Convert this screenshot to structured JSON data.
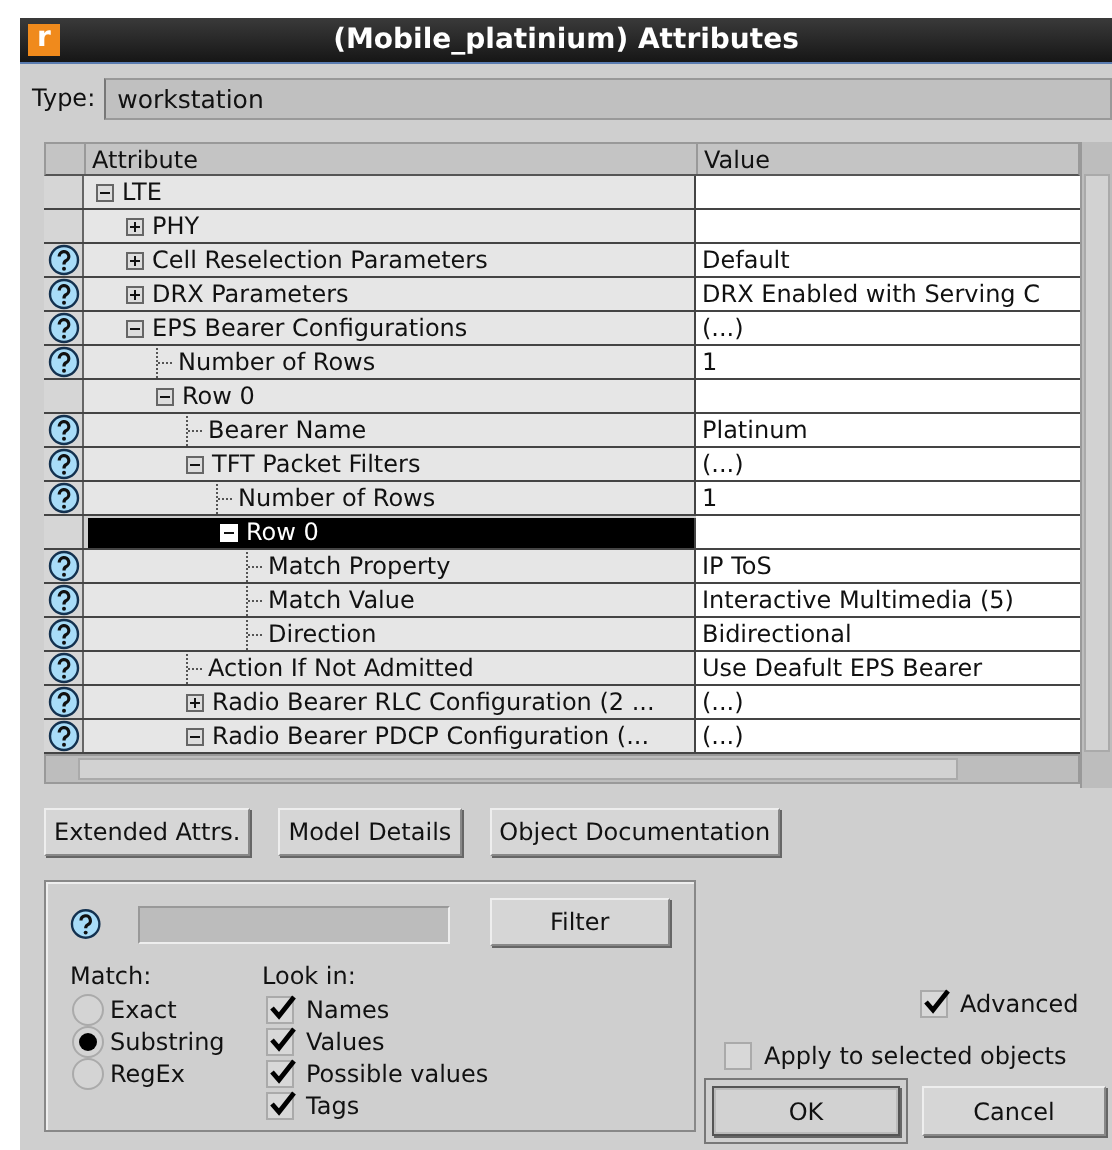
{
  "window": {
    "logo": "r",
    "title": "(Mobile_platinium) Attributes"
  },
  "type": {
    "label": "Type:",
    "value": "workstation"
  },
  "table": {
    "columns": [
      "Attribute",
      "Value"
    ],
    "rows": [
      {
        "name": "LTE",
        "kind": "group",
        "expanded": true,
        "help": false,
        "selected": false,
        "children": [
          {
            "name": "PHY",
            "kind": "group",
            "expanded": false,
            "help": false,
            "selected": false
          },
          {
            "name": "Cell Reselection Parameters",
            "value": "Default",
            "kind": "group",
            "expanded": false,
            "help": true,
            "selected": false
          },
          {
            "name": "DRX Parameters",
            "value": "DRX Enabled with Serving C",
            "kind": "group",
            "expanded": false,
            "help": true,
            "selected": false
          },
          {
            "name": "EPS Bearer Configurations",
            "value": "(...)",
            "kind": "group",
            "expanded": true,
            "help": true,
            "selected": false,
            "children": [
              {
                "name": "Number of Rows",
                "value": "1",
                "kind": "leaf",
                "help": true,
                "selected": false
              },
              {
                "name": "Row 0",
                "kind": "group",
                "expanded": true,
                "help": false,
                "selected": false,
                "children": [
                  {
                    "name": "Bearer Name",
                    "value": "Platinum",
                    "kind": "leaf",
                    "help": true,
                    "selected": false
                  },
                  {
                    "name": "TFT Packet Filters",
                    "value": "(...)",
                    "kind": "group",
                    "expanded": true,
                    "help": true,
                    "selected": false,
                    "children": [
                      {
                        "name": "Number of Rows",
                        "value": "1",
                        "kind": "leaf",
                        "help": true,
                        "selected": false
                      },
                      {
                        "name": "Row 0",
                        "kind": "group",
                        "expanded": true,
                        "help": false,
                        "selected": true,
                        "children": [
                          {
                            "name": "Match Property",
                            "value": "IP ToS",
                            "kind": "leaf",
                            "help": true,
                            "selected": false
                          },
                          {
                            "name": "Match Value",
                            "value": "Interactive Multimedia (5)",
                            "kind": "leaf",
                            "help": true,
                            "selected": false
                          },
                          {
                            "name": "Direction",
                            "value": "Bidirectional",
                            "kind": "leaf",
                            "help": true,
                            "selected": false
                          }
                        ]
                      }
                    ]
                  },
                  {
                    "name": "Action If Not Admitted",
                    "value": "Use Deafult EPS Bearer",
                    "kind": "leaf",
                    "help": true,
                    "selected": false
                  },
                  {
                    "name": "Radio Bearer RLC Configuration (2 ...",
                    "value": "(...)",
                    "kind": "group",
                    "expanded": false,
                    "help": true,
                    "selected": false
                  },
                  {
                    "name": "Radio Bearer PDCP Configuration (...",
                    "value": "(...)",
                    "kind": "group",
                    "expanded": true,
                    "help": true,
                    "selected": false
                  }
                ]
              }
            ]
          }
        ]
      }
    ]
  },
  "buttons": [
    {
      "label": "Extended Attrs."
    },
    {
      "label": "Model Details"
    },
    {
      "label": "Object Documentation"
    }
  ],
  "filter": {
    "button": "Filter",
    "match": {
      "label": "Match:",
      "options": [
        {
          "label": "Exact",
          "selected": false
        },
        {
          "label": "Substring",
          "selected": true
        },
        {
          "label": "RegEx",
          "selected": false
        }
      ]
    },
    "look_in": {
      "label": "Look in:",
      "options": [
        {
          "label": "Names",
          "checked": true
        },
        {
          "label": "Values",
          "checked": true
        },
        {
          "label": "Possible values",
          "checked": true
        },
        {
          "label": "Tags",
          "checked": true
        }
      ]
    }
  },
  "advanced": {
    "label": "Advanced",
    "checked": true
  },
  "apply": {
    "label": "Apply to selected objects",
    "checked": false
  },
  "dialog_buttons": [
    {
      "label": "OK",
      "default": true
    },
    {
      "label": "Cancel",
      "default": false
    }
  ]
}
